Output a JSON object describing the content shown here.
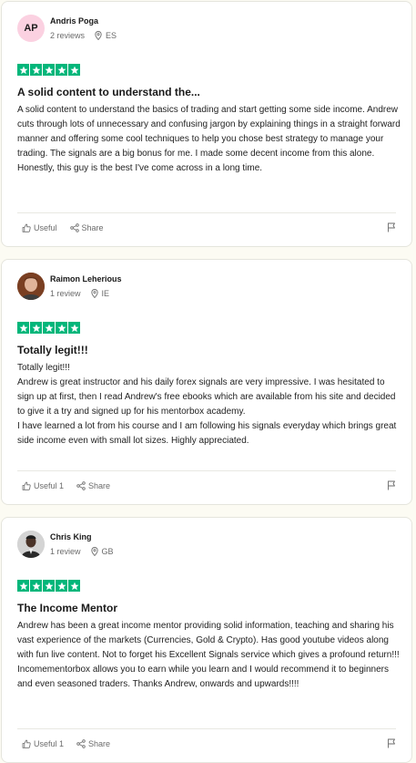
{
  "reviews": [
    {
      "initials": "AP",
      "name": "Andris Poga",
      "reviews_count": "2 reviews",
      "country": "ES",
      "rating": 5,
      "title": "A solid content to understand the...",
      "body": [
        "A solid content to understand the basics of trading and start getting some side income. Andrew cuts through lots of unnecessary and confusing jargon by explaining things in a straight forward manner and offering some cool techniques to help you chose best strategy to manage your trading. The signals are a big bonus for me. I made some decent income from this alone. Honestly, this guy is the best I've come across in a long time."
      ],
      "useful_label": "Useful",
      "share_label": "Share",
      "avatar_type": "initials"
    },
    {
      "initials": "",
      "name": "Raimon Leherious",
      "reviews_count": "1 review",
      "country": "IE",
      "rating": 5,
      "title": "Totally legit!!!",
      "body": [
        "Totally legit!!!",
        "Andrew is great instructor and his daily forex signals are very impressive. I was hesitated to sign up at first, then I read Andrew's free ebooks which are available from his site and decided to give it a try and signed up for his mentorbox academy.",
        "I have learned a lot from his course and I am following his signals everyday which brings great side income even with small lot sizes. Highly appreciated."
      ],
      "useful_label": "Useful 1",
      "share_label": "Share",
      "avatar_type": "photo-man-brown"
    },
    {
      "initials": "",
      "name": "Chris King",
      "reviews_count": "1 review",
      "country": "GB",
      "rating": 5,
      "title": "The Income Mentor",
      "body": [
        "Andrew has been a great income mentor providing solid information, teaching and sharing his vast experience of the markets (Currencies, Gold & Crypto). Has good youtube videos along with fun live content. Not to forget his Excellent Signals service which gives a profound return!!! Incomementorbox allows you to earn while you learn and I would recommend it to beginners and even seasoned traders. Thanks Andrew, onwards and upwards!!!!"
      ],
      "useful_label": "Useful 1",
      "share_label": "Share",
      "avatar_type": "photo-man-dark"
    }
  ],
  "colors": {
    "star_green": "#00b67a",
    "page_bg": "#fcfbf3",
    "avatar_pink": "#fbd1e1"
  },
  "icons": {
    "star": "star-icon",
    "location": "location-pin-icon",
    "useful": "thumbs-up-icon",
    "share": "share-icon",
    "report": "flag-icon"
  }
}
